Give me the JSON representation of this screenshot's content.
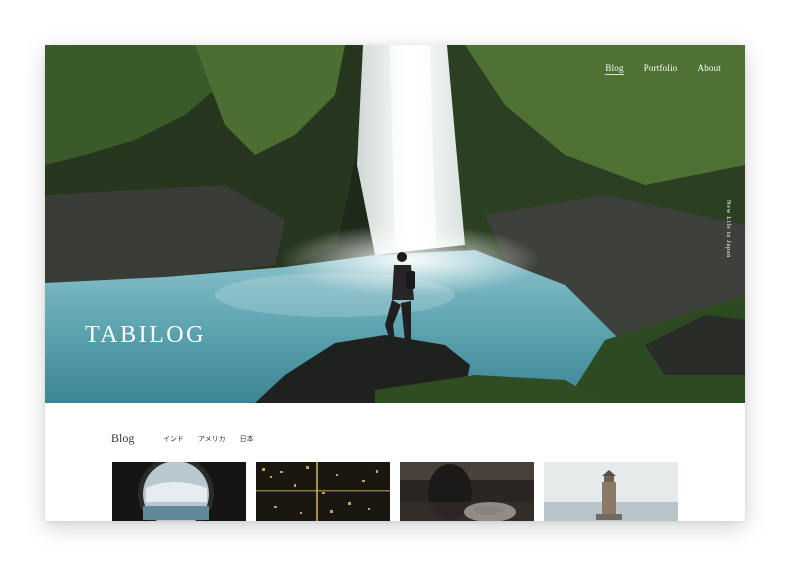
{
  "nav": {
    "items": [
      "Blog",
      "Portfolio",
      "About"
    ]
  },
  "hero": {
    "vertical_text": "New Life in Japan",
    "site_title": "TABILOG"
  },
  "blog": {
    "heading": "Blog",
    "tabs": [
      "インド",
      "アメリカ",
      "日本"
    ]
  },
  "colors": {
    "water": "#5fa3b0",
    "foliage": "#2f4a22",
    "text_light": "#ffffff"
  }
}
